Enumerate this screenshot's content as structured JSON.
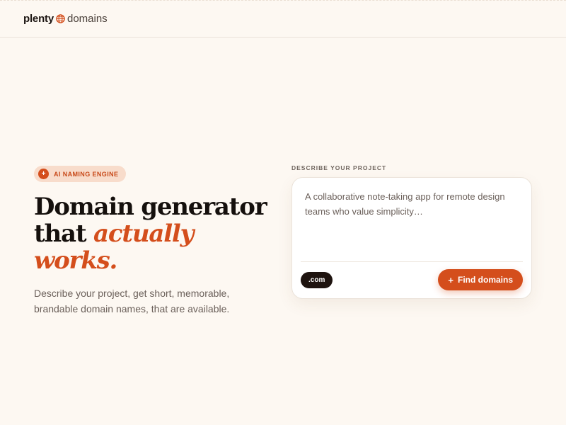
{
  "header": {
    "logo_part1": "plenty",
    "logo_part2": "domains",
    "logo_icon": "globe-icon"
  },
  "hero": {
    "badge_icon": "plus-icon",
    "badge_text": "AI NAMING ENGINE",
    "headline_line1": "Domain generator",
    "headline_line2_plain": "that ",
    "headline_line2_accent": "actually works.",
    "subtext": "Describe your project, get short, memorable, brandable domain names, that are available."
  },
  "panel": {
    "label": "DESCRIBE YOUR PROJECT",
    "textarea_value": "A collaborative note-taking app for remote design teams who value simplicity…",
    "tld": ".com",
    "find_button_icon": "plus-icon",
    "find_button_label": "Find domains"
  },
  "colors": {
    "background": "#fdf8f2",
    "accent": "#d44e1c",
    "badge_bg": "#f8dccb",
    "dark_chip": "#1e130f"
  }
}
